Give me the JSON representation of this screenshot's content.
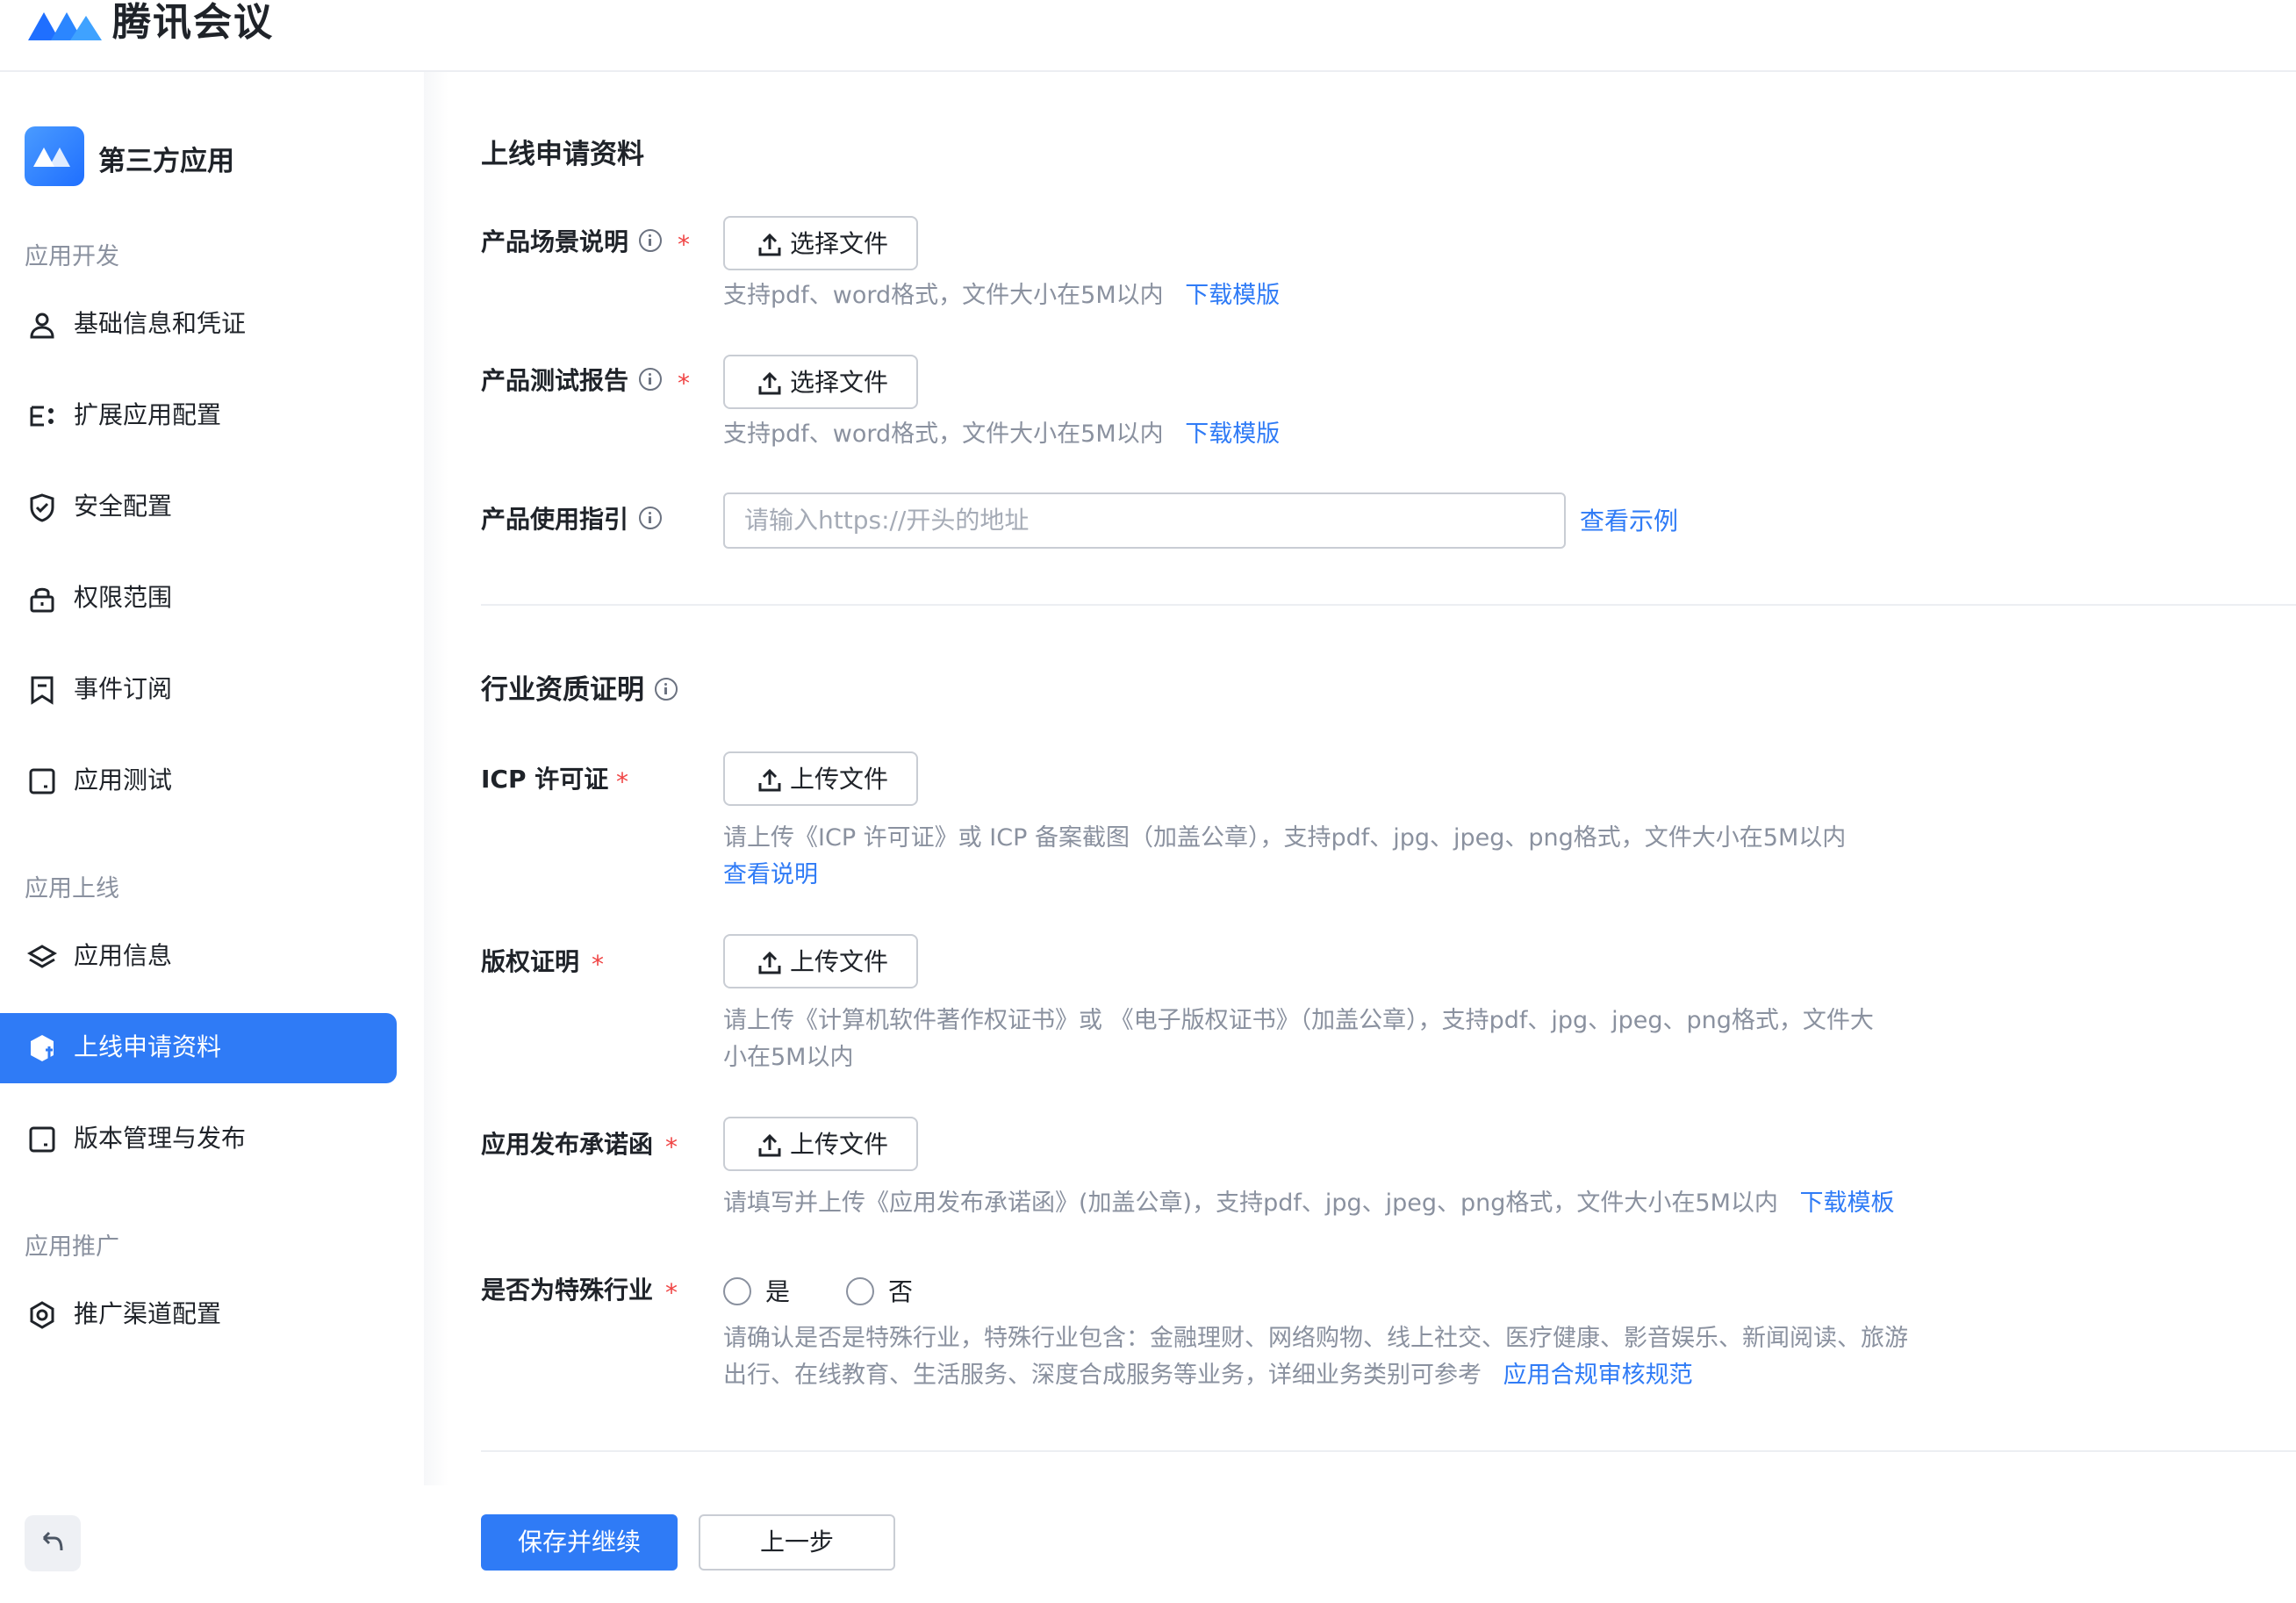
{
  "topbar": {
    "brand_name": "腾讯会议"
  },
  "sidebar": {
    "app_title": "第三方应用",
    "sections": [
      {
        "title": "应用开发"
      },
      {
        "title": "应用上线"
      },
      {
        "title": "应用推广"
      }
    ],
    "items": [
      {
        "label": "基础信息和凭证",
        "icon": "user-icon"
      },
      {
        "label": "扩展应用配置",
        "icon": "list-config-icon"
      },
      {
        "label": "安全配置",
        "icon": "shield-icon"
      },
      {
        "label": "权限范围",
        "icon": "lock-icon"
      },
      {
        "label": "事件订阅",
        "icon": "bookmark-icon"
      },
      {
        "label": "应用测试",
        "icon": "test-icon"
      },
      {
        "label": "应用信息",
        "icon": "layers-icon"
      },
      {
        "label": "上线申请资料",
        "icon": "submit-doc-icon",
        "active": true
      },
      {
        "label": "版本管理与发布",
        "icon": "version-icon"
      },
      {
        "label": "推广渠道配置",
        "icon": "gear-icon"
      }
    ]
  },
  "main": {
    "section1": {
      "title": "上线申请资料",
      "scenario": {
        "label": "产品场景说明",
        "button": "选择文件",
        "hint": "支持pdf、word格式，文件大小在5M以内",
        "link": "下载模版"
      },
      "test_report": {
        "label": "产品测试报告",
        "button": "选择文件",
        "hint": "支持pdf、word格式，文件大小在5M以内",
        "link": "下载模版"
      },
      "guide": {
        "label": "产品使用指引",
        "placeholder": "请输入https://开头的地址",
        "value": "",
        "link": "查看示例"
      }
    },
    "section2": {
      "title": "行业资质证明",
      "icp": {
        "label": "ICP 许可证",
        "button": "上传文件",
        "hint": "请上传《ICP 许可证》或 ICP 备案截图（加盖公章），支持pdf、jpg、jpeg、png格式，文件大小在5M以内",
        "link": "查看说明"
      },
      "copyright": {
        "label": "版权证明",
        "button": "上传文件",
        "hint_line1": "请上传《计算机软件著作权证书》或 《电子版权证书》（加盖公章），支持pdf、jpg、jpeg、png格式，文件大",
        "hint_line2": "小在5M以内"
      },
      "commitment": {
        "label": "应用发布承诺函",
        "button": "上传文件",
        "hint": "请填写并上传《应用发布承诺函》(加盖公章)，支持pdf、jpg、jpeg、png格式，文件大小在5M以内",
        "link": "下载模板"
      },
      "special": {
        "label": "是否为特殊行业",
        "options": [
          "是",
          "否"
        ],
        "selected": null,
        "hint_line1": "请确认是否是特殊行业，特殊行业包含：金融理财、网络购物、线上社交、医疗健康、影音娱乐、新闻阅读、旅游",
        "hint_line2": "出行、在线教育、生活服务、深度合成服务等业务，详细业务类别可参考",
        "link": "应用合规审核规范"
      }
    },
    "actions": {
      "primary": "保存并继续",
      "secondary": "上一步"
    }
  },
  "colors": {
    "accent": "#2f7bf6",
    "required": "#f04444",
    "hint": "#8a919f",
    "border": "#c9cdd4"
  }
}
